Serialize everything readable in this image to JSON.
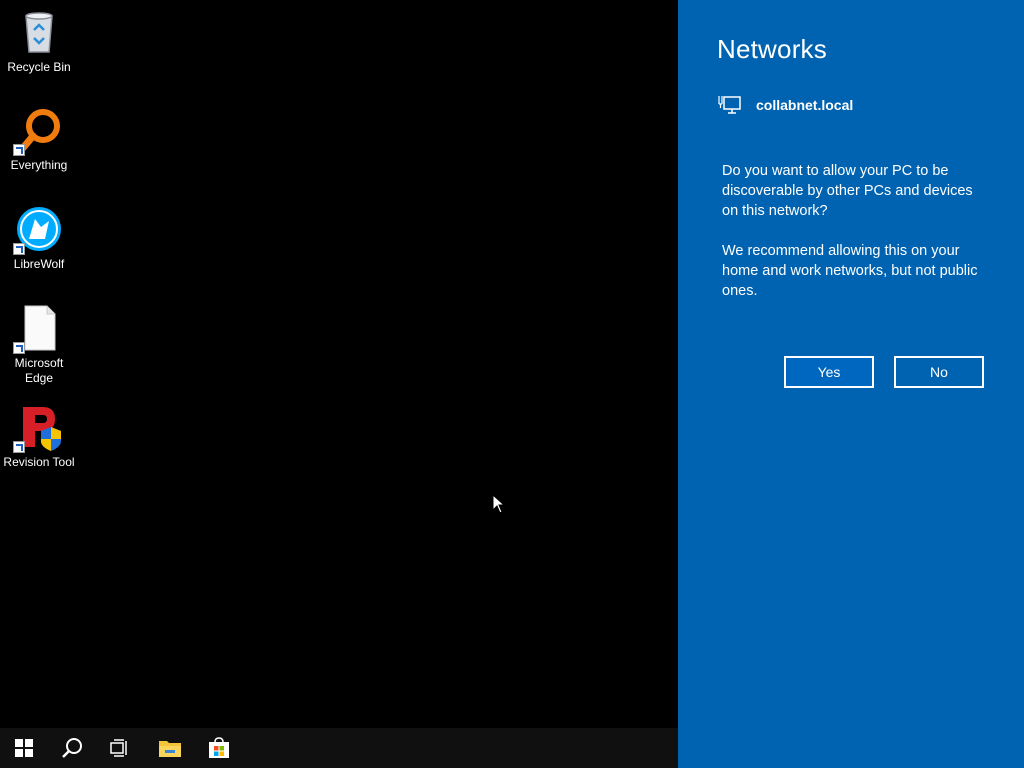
{
  "desktop": {
    "icons": [
      {
        "label": "Recycle Bin",
        "icon": "recycle-bin-icon"
      },
      {
        "label": "Everything",
        "icon": "everything-search-icon"
      },
      {
        "label": "LibreWolf",
        "icon": "librewolf-icon"
      },
      {
        "label": "Microsoft Edge",
        "icon": "blank-file-icon"
      },
      {
        "label": "Revision Tool",
        "icon": "revision-tool-icon"
      }
    ]
  },
  "taskbar": {
    "buttons": [
      "start-icon",
      "search-icon",
      "task-view-icon",
      "file-explorer-icon",
      "microsoft-store-icon"
    ]
  },
  "networks_flyout": {
    "title": "Networks",
    "network_name": "collabnet.local",
    "question": "Do you want to allow your PC to be discoverable by other PCs and devices on this network?",
    "recommendation": "We recommend allowing this on your home and work networks, but not public ones.",
    "yes_label": "Yes",
    "no_label": "No",
    "colors": {
      "panel": "#0063b1",
      "text": "#ffffff"
    }
  }
}
